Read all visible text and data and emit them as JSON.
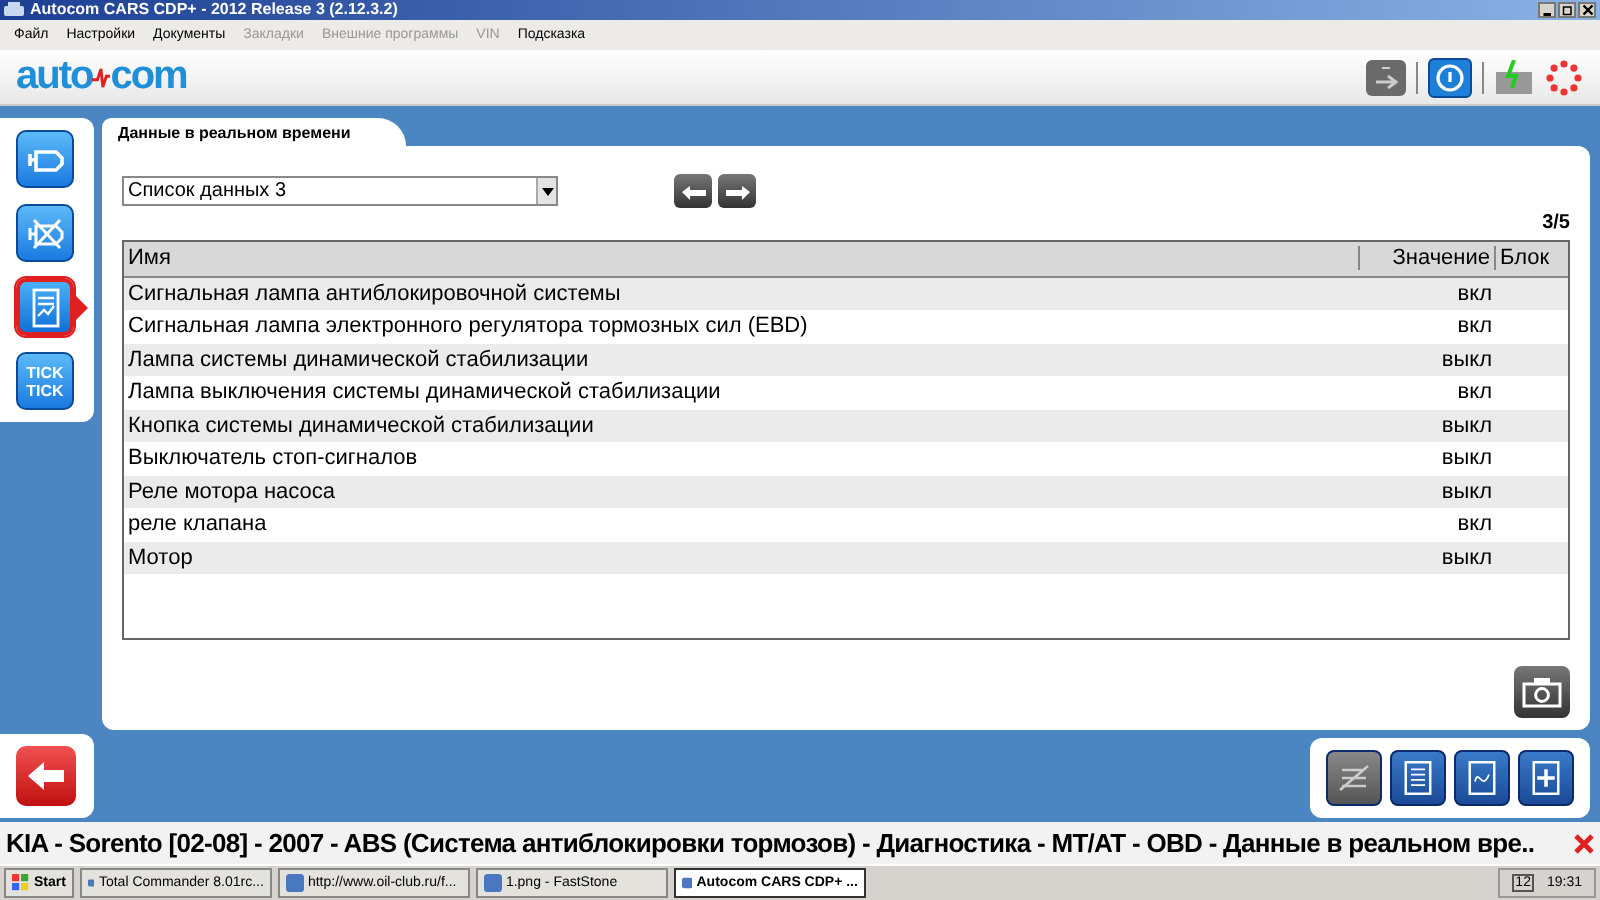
{
  "window": {
    "title": "Autocom CARS CDP+ - 2012 Release 3 (2.12.3.2)"
  },
  "menu": [
    {
      "label": "Файл",
      "disabled": false
    },
    {
      "label": "Настройки",
      "disabled": false
    },
    {
      "label": "Документы",
      "disabled": false
    },
    {
      "label": "Закладки",
      "disabled": true
    },
    {
      "label": "Внешние программы",
      "disabled": true
    },
    {
      "label": "VIN",
      "disabled": true
    },
    {
      "label": "Подсказка",
      "disabled": false
    }
  ],
  "logo": {
    "left": "auto",
    "right": "com"
  },
  "sidebar": {
    "items": [
      {
        "kind": "engine",
        "selected": false
      },
      {
        "kind": "clear",
        "selected": false
      },
      {
        "kind": "data",
        "selected": true
      },
      {
        "kind": "tick",
        "label": "TICK TICK",
        "selected": false
      }
    ]
  },
  "tab": {
    "label": "Данные в реальном времени"
  },
  "dataset": {
    "value": "Список данных 3"
  },
  "page": "3/5",
  "table": {
    "columns": [
      "Имя",
      "Значение",
      "Блок"
    ],
    "rows": [
      [
        "Сигнальная лампа антиблокировочной системы",
        "вкл",
        ""
      ],
      [
        "Сигнальная лампа электронного регулятора тормозных сил (EBD)",
        "вкл",
        ""
      ],
      [
        "Лампа системы динамической стабилизации",
        "выкл",
        ""
      ],
      [
        "Лампа выключения системы динамической стабилизации",
        "вкл",
        ""
      ],
      [
        "Кнопка системы динамической стабилизации",
        "выкл",
        ""
      ],
      [
        "Выключатель стоп-сигналов",
        "выкл",
        ""
      ],
      [
        "Реле мотора насоса",
        "выкл",
        ""
      ],
      [
        "реле клапана",
        "вкл",
        ""
      ],
      [
        "Мотор",
        "выкл",
        ""
      ]
    ]
  },
  "status_bar": {
    "text": "KIA - Sorento [02-08] - 2007 - ABS (Система антиблокировки тормозов) - Диагностика - MT/AT - OBD - Данные в реальном вре.."
  },
  "taskbar": {
    "start": "Start",
    "tasks": [
      {
        "label": "Total Commander 8.01rc...",
        "selected": false
      },
      {
        "label": "http://www.oil-club.ru/f...",
        "selected": false
      },
      {
        "label": "1.png - FastStone",
        "selected": false
      },
      {
        "label": "Autocom CARS CDP+ ...",
        "selected": true
      }
    ],
    "tray_badge": "12",
    "clock": "19:31"
  }
}
